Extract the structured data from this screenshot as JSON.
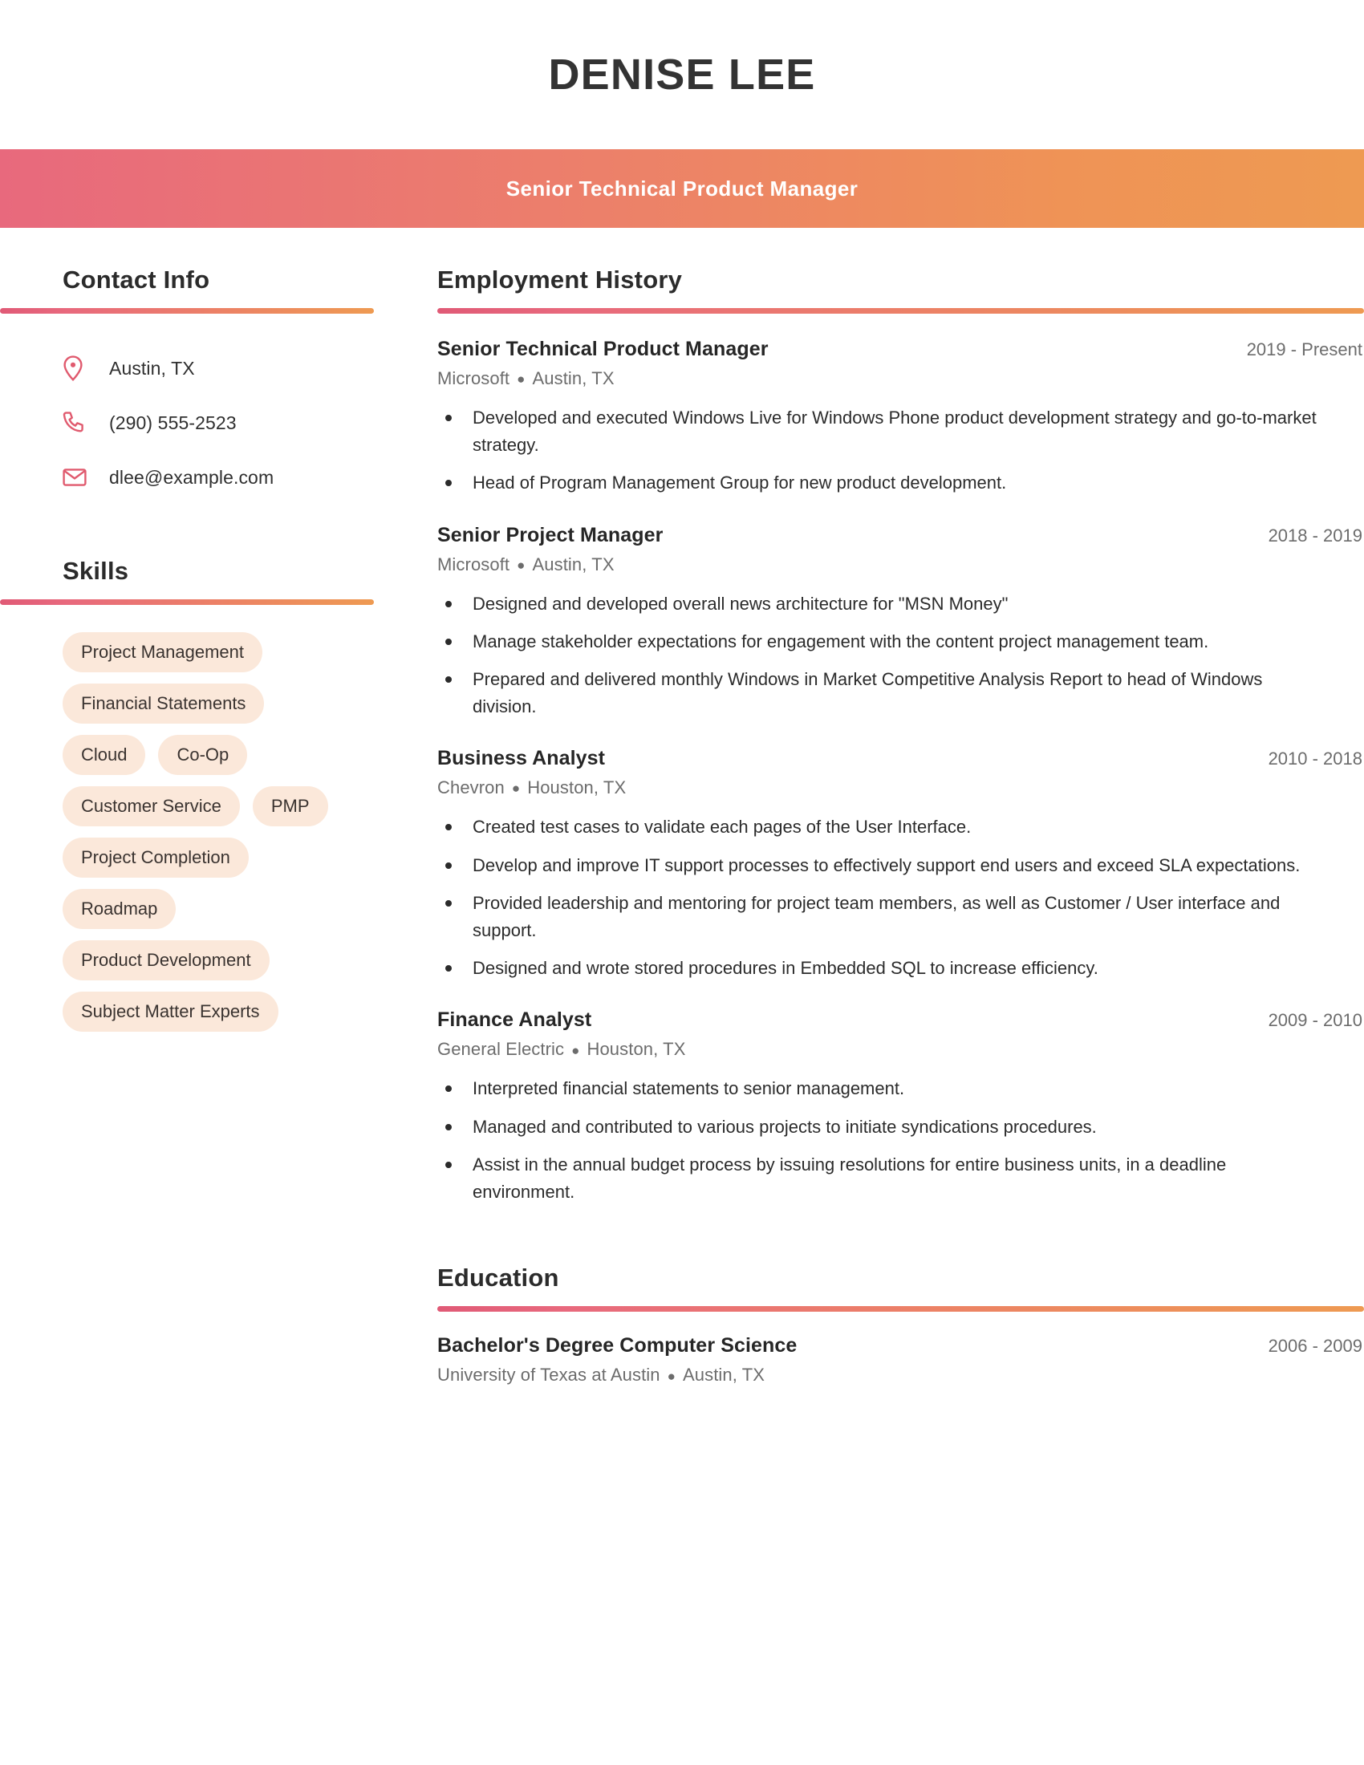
{
  "header": {
    "name": "DENISE LEE",
    "title": "Senior Technical Product Manager",
    "accent_start": "#e8697d",
    "accent_end": "#ee9a52"
  },
  "sidebar": {
    "contact": {
      "heading": "Contact Info",
      "items": [
        {
          "icon": "location-pin-icon",
          "value": "Austin, TX"
        },
        {
          "icon": "phone-icon",
          "value": "(290) 555-2523"
        },
        {
          "icon": "envelope-icon",
          "value": "dlee@example.com"
        }
      ]
    },
    "skills": {
      "heading": "Skills",
      "items": [
        "Project Management",
        "Financial Statements",
        "Cloud",
        "Co-Op",
        "Customer Service",
        "PMP",
        "Project Completion",
        "Roadmap",
        "Product Development",
        "Subject Matter Experts"
      ],
      "pill_color": "#fbe8da"
    }
  },
  "main": {
    "employment": {
      "heading": "Employment History",
      "entries": [
        {
          "role": "Senior Technical Product Manager",
          "dates": "2019 - Present",
          "company": "Microsoft",
          "location": "Austin, TX",
          "bullets": [
            "Developed and executed Windows Live for Windows Phone product development strategy and go-to-market strategy.",
            "Head of Program Management Group for new product development."
          ]
        },
        {
          "role": "Senior Project Manager",
          "dates": "2018 - 2019",
          "company": "Microsoft",
          "location": "Austin, TX",
          "bullets": [
            "Designed and developed overall news architecture for \"MSN Money\"",
            "Manage stakeholder expectations for engagement with the content project management team.",
            "Prepared and delivered monthly Windows in Market Competitive Analysis Report to head of Windows division."
          ]
        },
        {
          "role": "Business Analyst",
          "dates": "2010 - 2018",
          "company": "Chevron",
          "location": "Houston, TX",
          "bullets": [
            "Created test cases to validate each pages of the User Interface.",
            "Develop and improve IT support processes to effectively support end users and exceed SLA expectations.",
            "Provided leadership and mentoring for project team members, as well as Customer / User interface and support.",
            "Designed and wrote stored procedures in Embedded SQL to increase efficiency."
          ]
        },
        {
          "role": "Finance Analyst",
          "dates": "2009 - 2010",
          "company": "General Electric",
          "location": "Houston, TX",
          "bullets": [
            "Interpreted financial statements to senior management.",
            "Managed and contributed to various projects to initiate syndications procedures.",
            "Assist in the annual budget process by issuing resolutions for entire business units, in a deadline environment."
          ]
        }
      ]
    },
    "education": {
      "heading": "Education",
      "entries": [
        {
          "degree": "Bachelor's Degree Computer Science",
          "dates": "2006 - 2009",
          "school": "University of Texas at Austin",
          "location": "Austin, TX"
        }
      ]
    }
  }
}
